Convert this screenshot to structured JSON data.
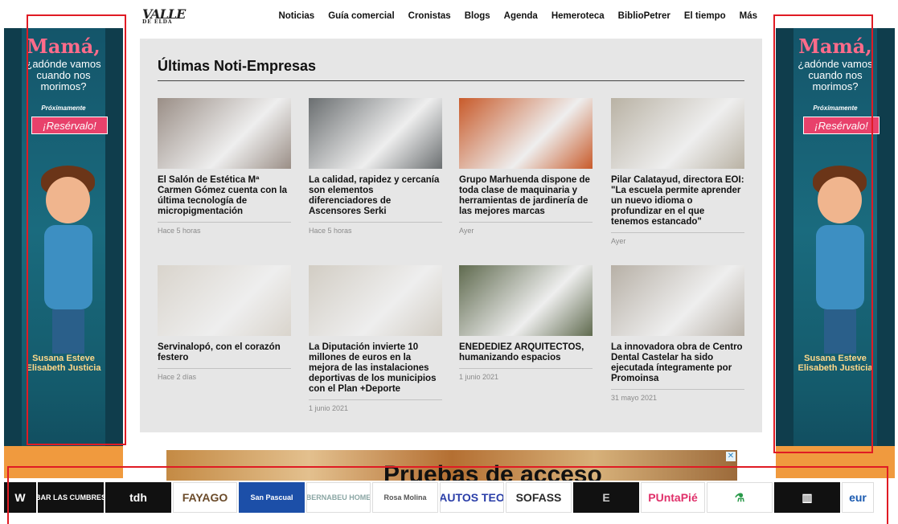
{
  "site": {
    "logo_text": "VALLE",
    "logo_sub": "DE ELDA"
  },
  "nav": {
    "items": [
      "Noticias",
      "Guía comercial",
      "Cronistas",
      "Blogs",
      "Agenda",
      "Hemeroteca",
      "BiblioPetrer",
      "El tiempo",
      "Más"
    ]
  },
  "side_ad": {
    "title": "Mamá,",
    "subtitle": "¿adónde vamos cuando nos morimos?",
    "soon": "Próximamente",
    "cta": "¡Resérvalo!",
    "authors_line1": "Susana Esteve",
    "authors_line2": "Elisabeth Justicia"
  },
  "main": {
    "title": "Últimas Noti-Empresas",
    "articles": [
      {
        "headline": "El Salón de Estética Mª Carmen Gómez cuenta con la última tecnología de micropigmentación",
        "time": "Hace 5 horas",
        "img_color": "#9a8e86"
      },
      {
        "headline": "La calidad, rapidez y cercanía son elementos diferenciadores de Ascensores Serki",
        "time": "Hace 5 horas",
        "img_color": "#6a6e70"
      },
      {
        "headline": "Grupo Marhuenda dispone de toda clase de maquinaria y herramientas de jardinería de las mejores marcas",
        "time": "Ayer",
        "img_color": "#c85a2a"
      },
      {
        "headline": "Pilar Calatayud, directora EOI: \"La escuela permite aprender un nuevo idioma o profundizar en el que tenemos estancado\"",
        "time": "Ayer",
        "img_color": "#b9b2a4"
      },
      {
        "headline": "Servinalopó, con el corazón festero",
        "time": "Hace 2 días",
        "img_color": "#d9d4cc"
      },
      {
        "headline": "La Diputación invierte 10 millones de euros en la mejora de las instalaciones deportivas de los municipios con el Plan +Deporte",
        "time": "1 junio 2021",
        "img_color": "#d2cdc4"
      },
      {
        "headline": "ENEDEDIEZ ARQUITECTOS, humanizando espacios",
        "time": "1 junio 2021",
        "img_color": "#5f6a4e"
      },
      {
        "headline": "La innovadora obra de Centro Dental Castelar ha sido ejecutada íntegramente por Promoinsa",
        "time": "31 mayo 2021",
        "img_color": "#b7b0a6"
      }
    ]
  },
  "banner": {
    "text": "Pruebas de acceso",
    "close": "✕"
  },
  "sponsors": [
    {
      "name": "W",
      "bg": "#111111",
      "fg": "#ffffff",
      "w": 40
    },
    {
      "name": "BAR LAS CUMBRES",
      "bg": "#111111",
      "fg": "#ffffff",
      "w": 82
    },
    {
      "name": "tdh",
      "bg": "#111111",
      "fg": "#ffffff",
      "w": 82
    },
    {
      "name": "FAYAGO",
      "bg": "#ffffff",
      "fg": "#6b4b2a",
      "w": 80
    },
    {
      "name": "San Pascual",
      "bg": "#1c4fa8",
      "fg": "#ffffff",
      "w": 82
    },
    {
      "name": "BERNABEU HOME",
      "bg": "#ffffff",
      "fg": "#8aa6a4",
      "w": 80
    },
    {
      "name": "Rosa Molina",
      "bg": "#ffffff",
      "fg": "#555555",
      "w": 82
    },
    {
      "name": "AUTOS TEO",
      "bg": "#ffffff",
      "fg": "#2a3ea8",
      "w": 80
    },
    {
      "name": "SOFASS",
      "bg": "#ffffff",
      "fg": "#2a2a2a",
      "w": 82
    },
    {
      "name": "E",
      "bg": "#111111",
      "fg": "#cccccc",
      "w": 82
    },
    {
      "name": "PUntaPié",
      "bg": "#ffffff",
      "fg": "#e0306a",
      "w": 80
    },
    {
      "name": "⚗",
      "bg": "#ffffff",
      "fg": "#2a9a4a",
      "w": 82
    },
    {
      "name": "▥",
      "bg": "#111111",
      "fg": "#ffffff",
      "w": 82
    },
    {
      "name": "eur",
      "bg": "#ffffff",
      "fg": "#1a5ab0",
      "w": 40
    }
  ]
}
